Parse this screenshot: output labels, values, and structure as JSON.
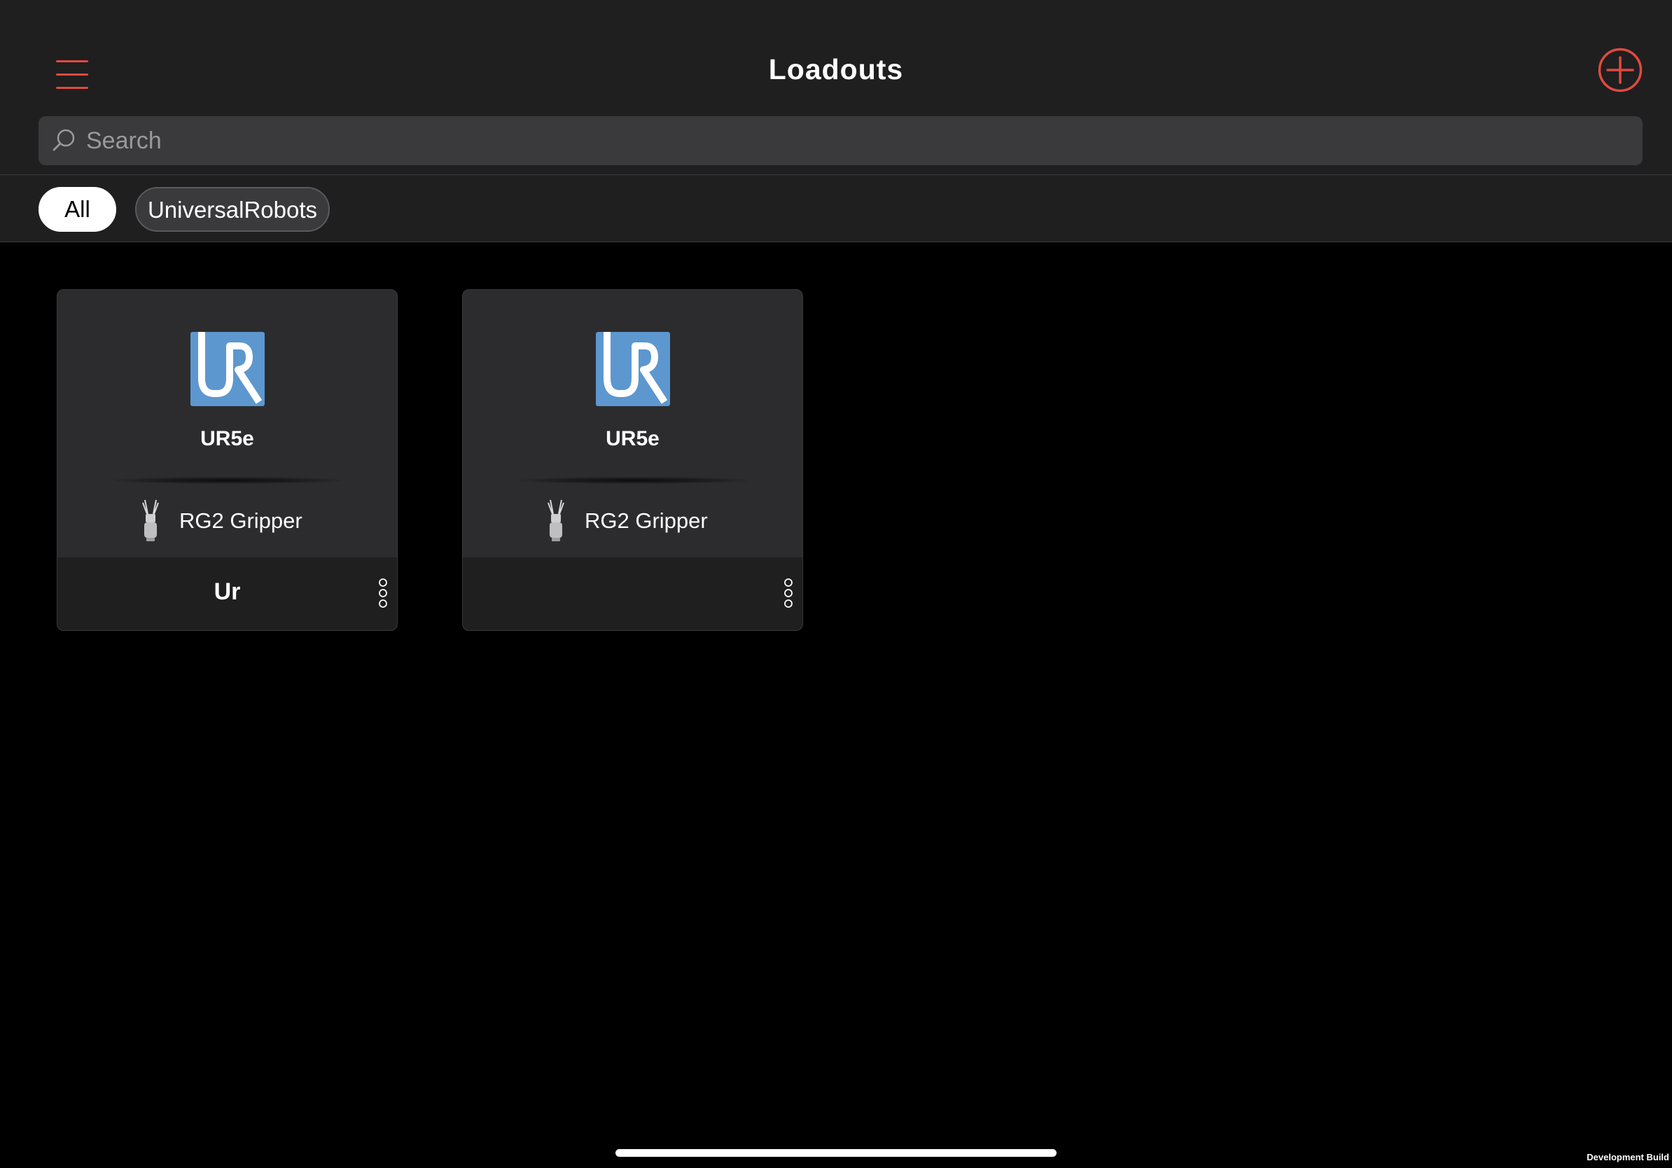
{
  "header": {
    "title": "Loadouts",
    "menu_icon": "hamburger-menu-icon",
    "add_icon": "plus-circle-icon"
  },
  "search": {
    "placeholder": "Search",
    "value": "",
    "icon": "search-icon"
  },
  "filters": [
    {
      "label": "All",
      "selected": true
    },
    {
      "label": "UniversalRobots",
      "selected": false
    }
  ],
  "loadouts": [
    {
      "robot": "UR5e",
      "robot_logo": "universal-robots-logo",
      "gripper": "RG2 Gripper",
      "gripper_icon": "rg2-gripper-icon",
      "name": "Ur",
      "more_icon": "more-vertical-icon"
    },
    {
      "robot": "UR5e",
      "robot_logo": "universal-robots-logo",
      "gripper": "RG2 Gripper",
      "gripper_icon": "rg2-gripper-icon",
      "name": "",
      "more_icon": "more-vertical-icon"
    }
  ],
  "footer": {
    "build_label": "Development Build"
  },
  "colors": {
    "accent": "#e04a3f",
    "background": "#000000",
    "header_bg": "#1f1f1f",
    "card_bg": "#2c2c2e",
    "search_bg": "#3a3a3c",
    "ur_logo_blue": "#5d97cf"
  }
}
